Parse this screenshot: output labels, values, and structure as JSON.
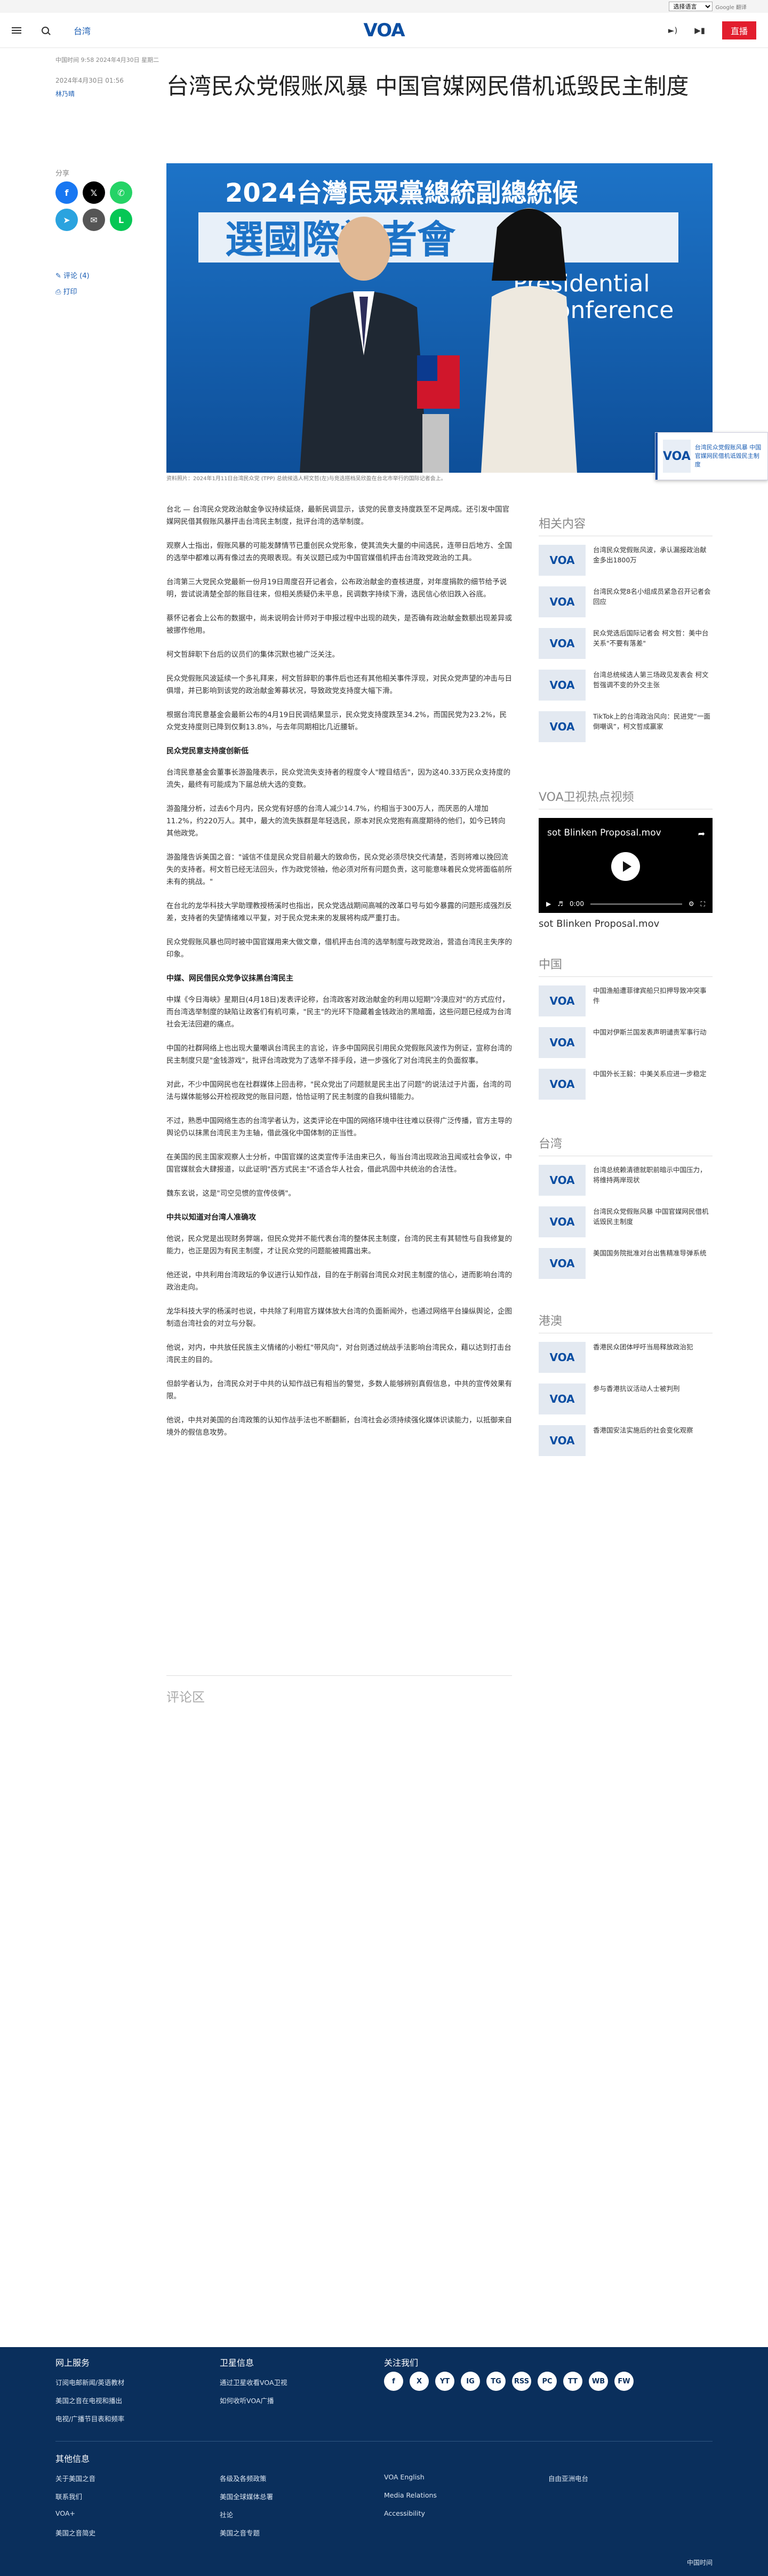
{
  "langbar": {
    "select_label": "选择语言",
    "provider": "Google 翻译"
  },
  "header": {
    "section": "台湾",
    "logo": "VOA",
    "live_label": "直播",
    "icons": [
      "menu-icon",
      "search-icon",
      "speaker-icon",
      "video-icon"
    ]
  },
  "article": {
    "meta_top": "中国时间 9:58 2024年4月30日 星期二",
    "date": "2024年4月30日 01:56",
    "author": "林乃晴",
    "title": "台湾民众党假账风暴 中国官媒网民借机诋毁民主制度",
    "share_label": "分享",
    "comments_link": "评论 (4)",
    "print_link": "打印",
    "hero": {
      "banner_top": "2024台灣民眾黨總統副總統候",
      "banner_main": "選國際記者會",
      "banner_en1": "Presidential",
      "banner_en2": "ss Conference"
    },
    "caption": "资料照片：2024年1月11日台湾民众党 (TPP) 总统候选人柯文哲(左)与竞选搭档吴欣盈在台北市举行的国际记者会上。",
    "paragraphs": [
      "台北 — 台湾民众党政治献金争议持续延烧，最新民调显示，该党的民意支持度跌至不足两成。还引发中国官媒网民借其假账风暴抨击台湾民主制度，批评台湾的选举制度。",
      "观察人士指出，假账风暴的可能发酵情节已重创民众党形象，使其流失大量的中间选民，连带日后地方、全国的选举中都难以再有像过去的亮眼表现。有关议题已成为中国官媒借机抨击台湾政党政治的工具。",
      "台湾第三大党民众党最新一份月19日周度召开记者会，公布政治献金的查核进度，对年度捐款的细节给予说明，尝试说清楚全部的账目往来，但相关质疑仍未平息，民调数字持续下滑，选民信心依旧跌入谷底。",
      "蔡怀记者会上公布的数据中，尚未说明会计师对于申报过程中出现的疏失，是否确有政治献金数额出现差异或被挪作他用。",
      "柯文哲辞职下台后的议员们的集体沉默也被广泛关注。",
      "民众党假账风波延续一个多礼拜来，柯文哲辞职的事件后也还有其他相关事件浮现，对民众党声望的冲击与日俱增，并已影响到该党的政治献金筹募状况，导致政党支持度大幅下滑。",
      "根据台湾民意基金会最新公布的4月19日民调结果显示，民众党支持度跌至34.2%，而国民党为23.2%，民众党支持度则已降到仅剩13.8%，与去年同期相比几近腰斩。"
    ],
    "sections": [
      {
        "heading": "民众党民意支持度创新低",
        "paragraphs": [
          "台湾民意基金会董事长游盈隆表示，民众党流失支持者的程度令人\"瞠目结舌\"，因为这40.33万民众支持度的流失，最终有可能成为下届总统大选的变数。",
          "游盈隆分析，过去6个月内，民众党有好感的台湾人减少14.7%，约相当于300万人，而厌恶的人增加11.2%，约220万人。其中，最大的流失族群是年轻选民，原本对民众党抱有高度期待的他们，如今已转向其他政党。",
          "游盈隆告诉美国之音：\"诚信不佳是民众党目前最大的致命伤，民众党必须尽快交代清楚，否则将难以挽回流失的支持者。柯文哲已经无法回头，作为政党领袖，他必须对所有问题负责，这可能意味着民众党将面临前所未有的挑战。\"",
          "在台北的龙华科技大学助理教授杨溪时也指出，民众党选战期间高喊的改革口号与如今暴露的问题形成强烈反差，支持者的失望情绪难以平复，对于民众党未来的发展将构成严重打击。",
          "民众党假账风暴也同时被中国官媒用来大做文章，借机抨击台湾的选举制度与政党政治，营造台湾民主失序的印象。"
        ]
      },
      {
        "heading": "中媒、网民借民众党争议抹黑台湾民主",
        "paragraphs": [
          "中媒《今日海峡》星期日(4月18日)发表评论称，台湾政客对政治献金的利用以短期\"冷漠应对\"的方式应付，而台湾选举制度的缺陷让政客们有机可乘，\"民主\"的光环下隐藏着金钱政治的黑暗面，这些问题已经成为台湾社会无法回避的痛点。",
          "中国的社群网络上也出现大量嘲讽台湾民主的言论，许多中国网民引用民众党假账风波作为例证，宣称台湾的民主制度只是\"金钱游戏\"，批评台湾政党为了选举不择手段，进一步强化了对台湾民主的负面叙事。",
          "对此，不少中国网民也在社群媒体上回击称，\"民众党出了问题就是民主出了问题\"的说法过于片面，台湾的司法与媒体能够公开检视政党的账目问题，恰恰证明了民主制度的自我纠错能力。",
          "不过，熟悉中国网络生态的台湾学者认为，这类评论在中国的网络环境中往往难以获得广泛传播，官方主导的舆论仍以抹黑台湾民主为主轴，借此强化中国体制的正当性。",
          "在美国的民主国家观察人士分析，中国官媒的这类宣传手法由来已久，每当台湾出现政治丑闻或社会争议，中国官媒就会大肆报道，以此证明\"西方式民主\"不适合华人社会，借此巩固中共统治的合法性。",
          "魏东玄说，这是\"司空见惯的宣传伎俩\"。"
        ]
      },
      {
        "heading": "中共以知道对台湾人准确攻",
        "paragraphs": [
          "他说，民众党是出现财务弊端，但民众党并不能代表台湾的整体民主制度，台湾的民主有其韧性与自我修复的能力，也正是因为有民主制度，才让民众党的问题能被揭露出来。",
          "他还说，中共利用台湾政坛的争议进行认知作战，目的在于削弱台湾民众对民主制度的信心，进而影响台湾的政治走向。",
          "龙华科技大学的杨溪时也说，中共除了利用官方媒体放大台湾的负面新闻外，也通过网络平台操纵舆论，企图制造台湾社会的对立与分裂。",
          "他说，对内，中共放任民族主义情绪的小粉红\"带风向\"，对台则透过统战手法影响台湾民众，藉以达到打击台湾民主的目的。",
          "但龄学者认为，台湾民众对于中共的认知作战已有相当的警觉，多数人能够辨别真假信息，中共的宣传效果有限。",
          "他说，中共对美国的台湾政策的认知作战手法也不断翻新，台湾社会必须持续强化媒体识读能力，以抵御来自境外的假信息攻势。"
        ]
      }
    ],
    "comments_heading": "评论区"
  },
  "right": {
    "related_title": "相关内容",
    "related": [
      "台湾民众党假账风波，承认漏报政治献金多出1800万",
      "台湾民众党8名小组成员紧急召开记者会回应",
      "民众党选后国际记者会 柯文哲：美中台关系\"不要有落差\"",
      "台湾总统候选人第三场政见发表会 柯文哲强调不变的外交主张",
      "TikTok上的台湾政治风向：民进党“一面倒嘲讽”，柯文哲成赢家"
    ],
    "video_title": "VOA卫视热点视频",
    "video_label": "sot Blinken Proposal.mov",
    "video_time": "0:00",
    "china_title": "中国",
    "china": [
      "中国渔船遭菲律宾船只扣押导致冲突事件",
      "中国对伊斯兰国发表声明谴责军事行动",
      "中国外长王毅：中美关系应进一步稳定"
    ],
    "taiwan_title": "台湾",
    "taiwan": [
      "台湾总统赖清德就职前暗示中国压力，将维持两岸现状",
      "台湾民众党假账风暴 中国官媒网民借机诋毁民主制度",
      "美国国务院批准对台出售精准导弹系统"
    ],
    "hk_title": "港澳",
    "hk": [
      "香港民众团体呼吁当局释放政治犯",
      "参与香港抗议活动人士被判刑",
      "香港国安法实施后的社会变化观察"
    ]
  },
  "footer": {
    "col1_title": "网上服务",
    "col1_links": [
      "订阅电邮新闻/英语教材",
      "美国之音在电视和播出",
      "电视/广播节目表和频率"
    ],
    "col2_title": "卫星信息",
    "col2_links": [
      "通过卫星收看VOA卫视",
      "如何收听VOA广播"
    ],
    "col3_title": "关注我们",
    "social": [
      "f",
      "X",
      "YT",
      "IG",
      "TG",
      "RSS",
      "PC",
      "TT",
      "WB",
      "FW"
    ],
    "other_title": "其他信息",
    "other_cols": [
      [
        "关于美国之音",
        "联系我们",
        "VOA+",
        "美国之音简史"
      ],
      [
        "各级及各频政策",
        "美国全球媒体总署",
        "社论",
        "美国之音专题"
      ],
      [
        "VOA English",
        "Media Relations",
        "Accessibility"
      ],
      [
        "自由亚洲电台"
      ]
    ],
    "copyright": "中国时间"
  },
  "colors": {
    "brand": "#0b4ea2",
    "live": "#e21d2d",
    "footer_bg": "#0a2f5c",
    "link": "#1a5db3"
  }
}
